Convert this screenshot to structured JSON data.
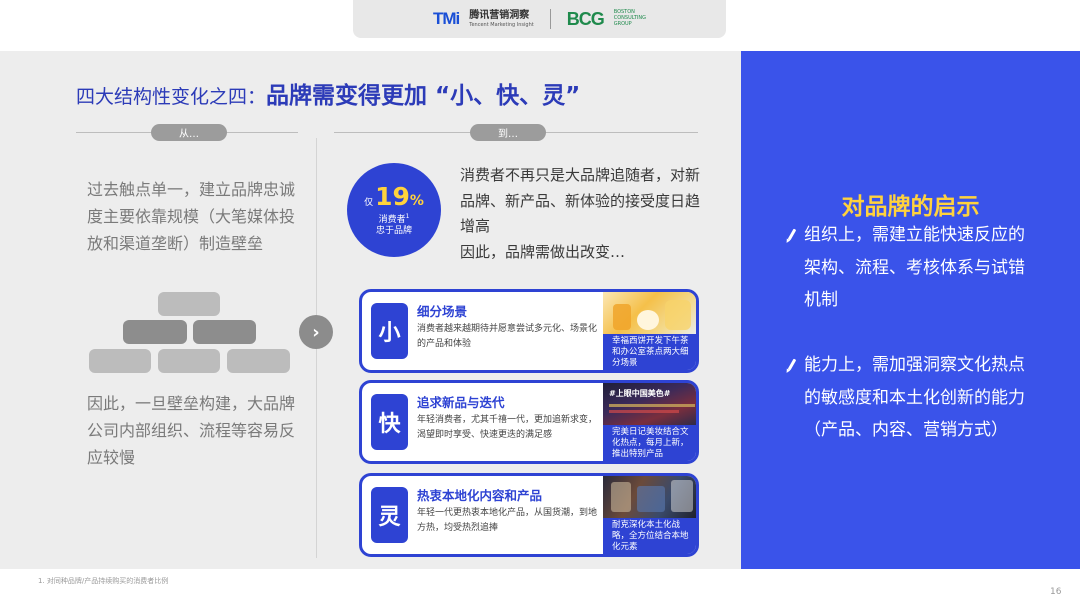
{
  "header": {
    "tmi_logo": "TMi",
    "tmi_name_cn": "腾讯营销洞察",
    "tmi_name_en": "Tencent Marketing Insight",
    "bcg_logo": "BCG",
    "bcg_name": "BOSTON\nCONSULTING\nGROUP"
  },
  "title": {
    "prefix": "四大结构性变化之四：",
    "highlight": "品牌需变得更加 “小、快、灵”"
  },
  "from": {
    "label": "从…",
    "text_top": "过去触点单一，建立品牌忠诚度主要依靠规模（大笔媒体投放和渠道垄断）制造壁垒",
    "text_bottom": "因此，一旦壁垒构建，大品牌公司内部组织、流程等容易反应较慢"
  },
  "to": {
    "label": "到…",
    "stat": {
      "prefix": "仅",
      "value": "19",
      "unit": "%",
      "label_line1": "消费者",
      "label_line2": "忠于品牌",
      "footnote_mark": "1"
    },
    "text": "消费者不再只是大品牌追随者，对新品牌、新产品、新体验的接受度日趋增高\n因此，品牌需做出改变…"
  },
  "cards": [
    {
      "badge": "小",
      "title": "细分场景",
      "desc": "消费者越来越期待并愿意尝试多元化、场景化的产品和体验",
      "caption": "幸福西饼开发下午茶和办公室茶点两大细分场景"
    },
    {
      "badge": "快",
      "title": "追求新品与迭代",
      "desc": "年轻消费者，尤其千禧一代，更加追新求变，渴望即时享受、快速更迭的满足感",
      "caption": "完美日记美妆结合文化热点，每月上新，推出特别产品",
      "image_text": "#上眼中国美色#"
    },
    {
      "badge": "灵",
      "title": "热衷本地化内容和产品",
      "desc": "年轻一代更热衷本地化产品，从国货潮，到地方热，均受热烈追捧",
      "caption": "耐克深化本土化战略，全方位结合本地化元素"
    }
  ],
  "insights": {
    "title": "对品牌的启示",
    "points": [
      "组织上，需建立能快速反应的架构、流程、考核体系与试错机制",
      "能力上，需加强洞察文化热点的敏感度和本土化创新的能力（产品、内容、营销方式）"
    ]
  },
  "footnote": "1. 对同种品牌/产品持续购买的消费者比例",
  "page_number": "16",
  "colors": {
    "accent": "#2e43d3",
    "panel": "#3a53ea",
    "highlight": "#ffd23d",
    "bg": "#ededed"
  }
}
